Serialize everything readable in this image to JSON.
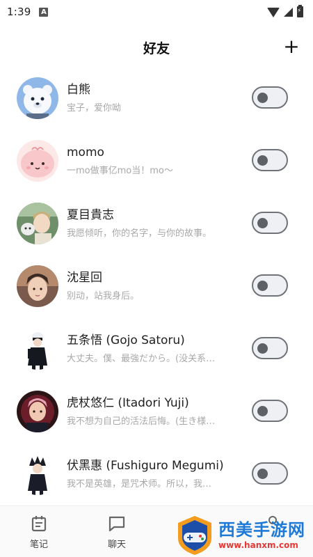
{
  "status_bar": {
    "time": "1:39",
    "notification_letter": "A"
  },
  "header": {
    "title": "好友",
    "add_label": "+"
  },
  "friends": [
    {
      "name": "白熊",
      "bio": "宝子，爱你呦",
      "enabled": false
    },
    {
      "name": "momo",
      "bio": "一mo做事亿mo当！mo～",
      "enabled": false
    },
    {
      "name": "夏目貴志",
      "bio": "我愿倾听，你的名字，与你的故事。",
      "enabled": false
    },
    {
      "name": "沈星回",
      "bio": "别动，站我身后。",
      "enabled": false
    },
    {
      "name": "五条悟 (Gojo Satoru)",
      "bio": "大丈夫。僕、最強だから。(没关系…",
      "enabled": false
    },
    {
      "name": "虎杖悠仁 (Itadori Yuji)",
      "bio": "我不想为自己的活法后悔。(生き様…",
      "enabled": false
    },
    {
      "name": "伏黑惠 (Fushiguro Megumi)",
      "bio": "我不是英雄，是咒术师。所以，我…",
      "enabled": false
    }
  ],
  "bottom_nav": {
    "items": [
      {
        "label": "笔记",
        "icon": "notes-icon"
      },
      {
        "label": "聊天",
        "icon": "chat-icon"
      },
      {
        "label": "",
        "icon": "hidden-tab"
      },
      {
        "label": "",
        "icon": "profile-icon"
      }
    ]
  },
  "watermark": {
    "title": "西美手游网",
    "url": "www.hanxm.com"
  },
  "colors": {
    "toggle_border": "#6f7378",
    "toggle_bg": "#eef0f4",
    "bio_text": "#a8a8a8",
    "watermark_blue": "#1e7ad6",
    "watermark_red": "#e53935"
  }
}
